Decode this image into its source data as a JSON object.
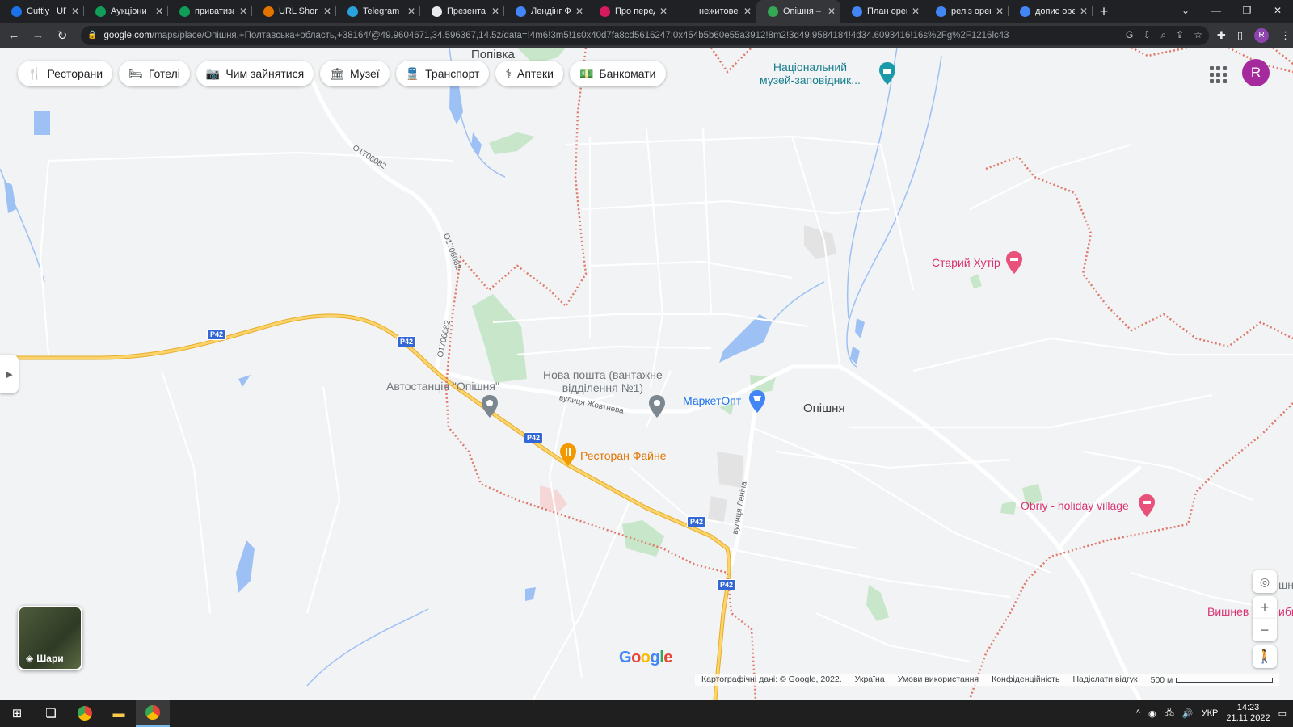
{
  "browser": {
    "tabs": [
      {
        "title": "Cuttly | URL",
        "color": "#1a73e8",
        "active": false
      },
      {
        "title": "Аукціони п",
        "color": "#0f9d58",
        "active": false
      },
      {
        "title": "приватиза",
        "color": "#0f9d58",
        "active": false
      },
      {
        "title": "URL Shorter",
        "color": "#e37400",
        "active": false
      },
      {
        "title": "Telegram",
        "color": "#2aa1da",
        "active": false
      },
      {
        "title": "Презентац",
        "color": "#e8eaed",
        "active": false
      },
      {
        "title": "Лендінг ФД",
        "color": "#4285f4",
        "active": false
      },
      {
        "title": "Про перед",
        "color": "#d81b60",
        "active": false
      },
      {
        "title": "нежитове",
        "color": "#202124",
        "active": false
      },
      {
        "title": "Опішня – К",
        "color": "#34a853",
        "active": true
      },
      {
        "title": "План орен",
        "color": "#4285f4",
        "active": false
      },
      {
        "title": "реліз орен",
        "color": "#4285f4",
        "active": false
      },
      {
        "title": "допис орен",
        "color": "#4285f4",
        "active": false
      }
    ],
    "new_tab_label": "+",
    "url_domain": "google.com",
    "url_path": "/maps/place/Опішня,+Полтавська+область,+38164/@49.9604671,34.596367,14.5z/data=!4m6!3m5!1s0x40d7fa8cd5616247:0x454b5b60e55a3912!8m2!3d49.9584184!4d34.6093416!16s%2Fg%2F1216lc43",
    "profile_initial": "R"
  },
  "maps": {
    "chips": [
      {
        "icon": "restaurant-icon",
        "glyph": "🍴",
        "label": "Ресторани"
      },
      {
        "icon": "hotel-icon",
        "glyph": "🛏",
        "label": "Готелі"
      },
      {
        "icon": "camera-icon",
        "glyph": "📷",
        "label": "Чим зайнятися"
      },
      {
        "icon": "museum-icon",
        "glyph": "🏛",
        "label": "Музеї"
      },
      {
        "icon": "transit-icon",
        "glyph": "🚆",
        "label": "Транспорт"
      },
      {
        "icon": "pharmacy-icon",
        "glyph": "⚕",
        "label": "Аптеки"
      },
      {
        "icon": "atm-icon",
        "glyph": "💵",
        "label": "Банкомати"
      }
    ],
    "account_initial": "R",
    "labels": {
      "popivka": "Попівка",
      "museum": "Національний\nмузей-заповідник...",
      "staryi_khutir": "Старий Хутір",
      "nova_poshta": "Нова пошта (вантажне\nвідділення №1)",
      "bus_station": "Автостанція \"Опішня\"",
      "marketopt": "МаркетОпт",
      "opishnia": "Опішня",
      "restaurant": "Ресторан Файне",
      "obriy": "Obriy - holiday village",
      "vyshnev": "Вишнев",
      "vyshnev_tail": "иби",
      "nia": "шня",
      "street_zhovtneva": "вулиця Жовтнева",
      "street_lenina": "вулиця Леніна",
      "road_o1": "О1706082",
      "road_o2": "О1706082",
      "road_o3": "О1706082",
      "p42": "Р42"
    },
    "layers_label": "Шари",
    "google_logo": "Google",
    "footer": {
      "copyright": "Картографічні дані: © Google, 2022.",
      "country": "Україна",
      "terms": "Умови використання",
      "privacy": "Конфіденційність",
      "feedback": "Надіслати відгук",
      "scale": "500 м"
    }
  },
  "taskbar": {
    "language": "УКР",
    "time": "14:23",
    "date": "21.11.2022"
  }
}
